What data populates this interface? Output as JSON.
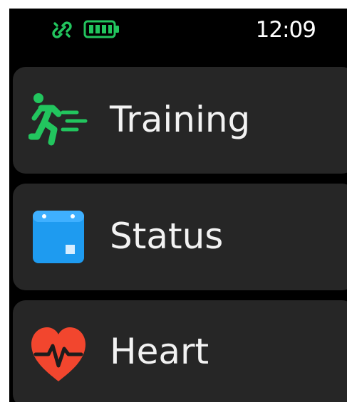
{
  "status_bar": {
    "time": "12:09",
    "link_icon": "broken-link-icon",
    "battery_icon": "battery-full-icon",
    "icon_color": "#22c55e"
  },
  "menu": {
    "items": [
      {
        "label": "Training",
        "icon": "running-person-icon",
        "icon_color": "#22c55e"
      },
      {
        "label": "Status",
        "icon": "calendar-icon",
        "icon_color": "#1e9bf0"
      },
      {
        "label": "Heart",
        "icon": "heart-pulse-icon",
        "icon_color": "#f2462e"
      }
    ]
  },
  "colors": {
    "background": "#000000",
    "card": "#262626",
    "text": "#f2f2f2"
  }
}
